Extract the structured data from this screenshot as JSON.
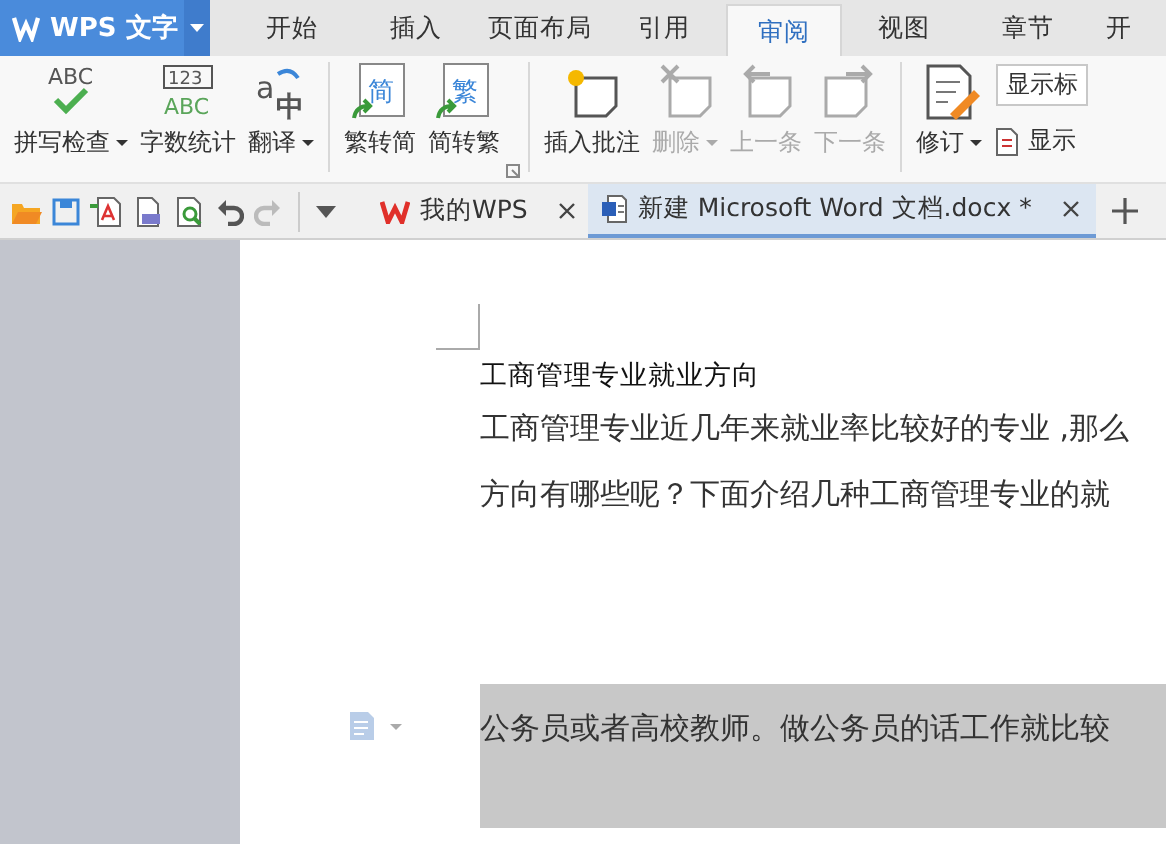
{
  "app_menu": {
    "label": "WPS 文字"
  },
  "tabs": [
    {
      "label": "开始",
      "selected": false
    },
    {
      "label": "插入",
      "selected": false
    },
    {
      "label": "页面布局",
      "selected": false
    },
    {
      "label": "引用",
      "selected": false
    },
    {
      "label": "审阅",
      "selected": true
    },
    {
      "label": "视图",
      "selected": false
    },
    {
      "label": "章节",
      "selected": false
    },
    {
      "label": "开",
      "selected": false
    }
  ],
  "ribbon": {
    "items": [
      {
        "label": "拼写检查",
        "dropdown": true,
        "disabled": false,
        "icon_texts": [
          "ABC"
        ]
      },
      {
        "label": "字数统计",
        "dropdown": false,
        "disabled": false,
        "icon_texts": [
          "123",
          "ABC"
        ]
      },
      {
        "label": "翻译",
        "dropdown": true,
        "disabled": false,
        "icon_texts": [
          "a",
          "中"
        ]
      },
      {
        "label": "繁转简",
        "dropdown": false,
        "disabled": false,
        "icon_texts": [
          "简"
        ]
      },
      {
        "label": "简转繁",
        "dropdown": false,
        "disabled": false,
        "icon_texts": [
          "繁"
        ]
      },
      {
        "label": "插入批注",
        "dropdown": false,
        "disabled": false
      },
      {
        "label": "删除",
        "dropdown": true,
        "disabled": true
      },
      {
        "label": "上一条",
        "dropdown": false,
        "disabled": true
      },
      {
        "label": "下一条",
        "dropdown": false,
        "disabled": true
      },
      {
        "label": "修订",
        "dropdown": true,
        "disabled": false
      }
    ],
    "markup_field": {
      "value": "显示标"
    },
    "show_option": {
      "label": "显示"
    }
  },
  "doc_tabs": [
    {
      "label": "我的WPS",
      "selected": false
    },
    {
      "label": "新建 Microsoft Word 文档.docx *",
      "selected": true
    }
  ],
  "document": {
    "heading": "工商管理专业就业方向",
    "paragraphs": [
      {
        "text": "工商管理专业近几年来就业率比较好的专业 ,那么",
        "selected": false
      },
      {
        "text": "方向有哪些呢？下面介绍几种工商管理专业的就",
        "selected": false
      },
      {
        "text": "公务员或者高校教师。做公务员的话工作就比较",
        "selected": true
      }
    ]
  }
}
